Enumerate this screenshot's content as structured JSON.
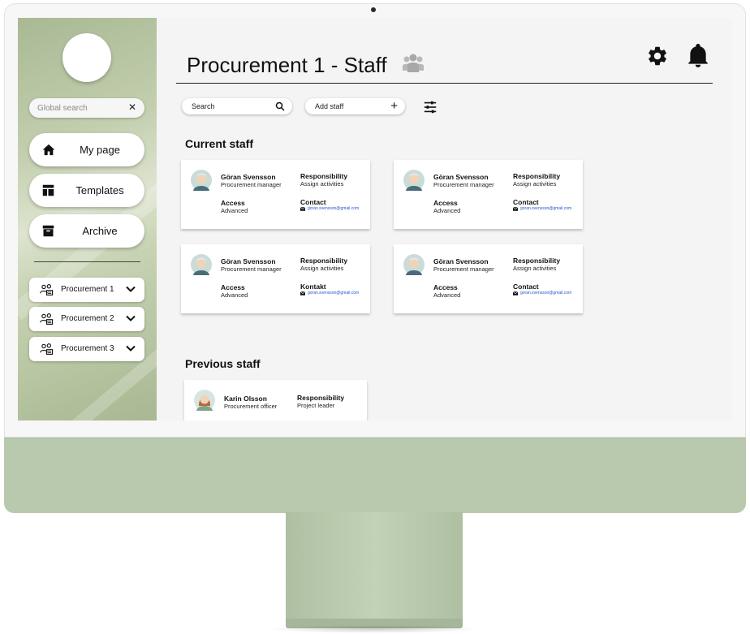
{
  "sidebar": {
    "search": {
      "placeholder": "Global search",
      "clear_icon": "close-icon"
    },
    "nav": [
      {
        "label": "My page",
        "icon": "home-icon"
      },
      {
        "label": "Templates",
        "icon": "templates-icon"
      },
      {
        "label": "Archive",
        "icon": "archive-icon"
      }
    ],
    "procurements": [
      {
        "label": "Procurement 1",
        "icon": "group-icon"
      },
      {
        "label": "Procurement 2",
        "icon": "group-icon"
      },
      {
        "label": "Procurement 3",
        "icon": "group-icon"
      }
    ]
  },
  "header": {
    "title": "Procurement 1 - Staff",
    "title_icon": "people-icon",
    "settings_icon": "gear-icon",
    "notifications_icon": "bell-icon"
  },
  "toolbar": {
    "search_placeholder": "Search",
    "add_label": "Add staff",
    "add_icon": "+"
  },
  "current_staff": {
    "title": "Current staff",
    "cards": [
      {
        "name": "Göran Svensson",
        "role": "Procurement manager",
        "responsibility_label": "Responsibility",
        "responsibility": "Assign activities",
        "access_label": "Access",
        "access": "Advanced",
        "contact_label": "Contact",
        "email": "goran.svensson@gmail.com"
      },
      {
        "name": "Göran Svensson",
        "role": "Procurement manager",
        "responsibility_label": "Responsibility",
        "responsibility": "Assign activities",
        "access_label": "Access",
        "access": "Advanced",
        "contact_label": "Contact",
        "email": "goran.svensson@gmail.com"
      },
      {
        "name": "Göran Svensson",
        "role": "Procurement manager",
        "responsibility_label": "Responsibility",
        "responsibility": "Assign activities",
        "access_label": "Access",
        "access": "Advanced",
        "contact_label": "Kontakt",
        "email": "goran.svensson@gmail.com"
      },
      {
        "name": "Göran Svensson",
        "role": "Procurement manager",
        "responsibility_label": "Responsibility",
        "responsibility": "Assign activities",
        "access_label": "Access",
        "access": "Advanced",
        "contact_label": "Contact",
        "email": "goran.svensson@gmail.com"
      }
    ]
  },
  "previous_staff": {
    "title": "Previous staff",
    "cards": [
      {
        "name": "Karin Olsson",
        "role": "Procurement officer",
        "responsibility_label": "Responsibility",
        "responsibility": "Project leader"
      }
    ]
  },
  "colors": {
    "sidebar_green": "#b7c6a3",
    "chin_green": "#b9c9ad",
    "link_blue": "#2255cc"
  }
}
